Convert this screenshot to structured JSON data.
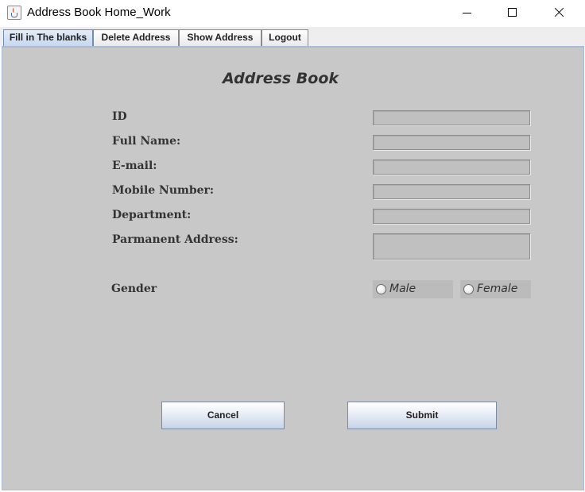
{
  "window": {
    "title": "Address Book Home_Work",
    "app_icon": "java-cup-icon",
    "controls": [
      "minimize-icon",
      "maximize-icon",
      "close-icon"
    ]
  },
  "tabs": [
    {
      "label": "Fill in The blanks",
      "selected": true
    },
    {
      "label": "Delete Address",
      "selected": false
    },
    {
      "label": "Show Address",
      "selected": false
    },
    {
      "label": "Logout",
      "selected": false
    }
  ],
  "form": {
    "heading": "Address Book",
    "fields": [
      {
        "label": "ID",
        "value": ""
      },
      {
        "label": "Full Name:",
        "value": ""
      },
      {
        "label": "E-mail:",
        "value": ""
      },
      {
        "label": "Mobile Number:",
        "value": ""
      },
      {
        "label": "Department:",
        "value": ""
      },
      {
        "label": "Parmanent Address:",
        "value": ""
      }
    ],
    "gender": {
      "label": "Gender",
      "options": [
        {
          "label": "Male",
          "selected": false
        },
        {
          "label": "Female",
          "selected": false
        }
      ]
    }
  },
  "buttons": {
    "cancel": "Cancel",
    "submit": "Submit"
  },
  "colors": {
    "panel": "#c8c8c8",
    "field": "#c0c0c0",
    "active_tab": "#c7d8ee",
    "label_text": "#333333"
  }
}
